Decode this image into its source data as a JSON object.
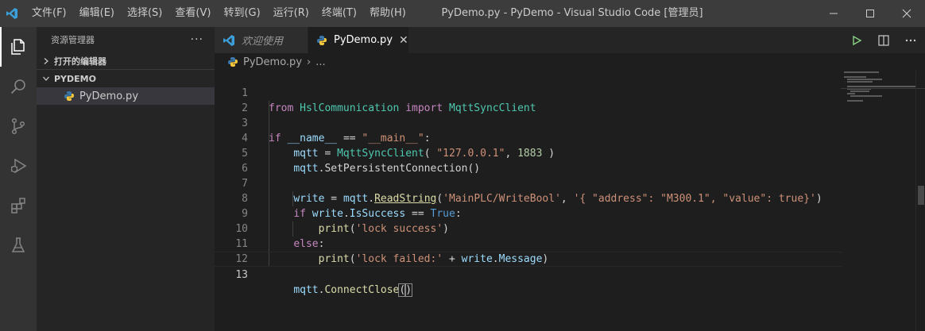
{
  "titlebar": {
    "menu": [
      "文件(F)",
      "编辑(E)",
      "选择(S)",
      "查看(V)",
      "转到(G)",
      "运行(R)",
      "终端(T)",
      "帮助(H)"
    ],
    "window_title": "PyDemo.py - PyDemo - Visual Studio Code [管理员]"
  },
  "activity_bar": {
    "items": [
      "explorer-icon",
      "search-icon",
      "source-control-icon",
      "run-debug-icon",
      "extensions-icon",
      "testing-icon"
    ]
  },
  "sidebar": {
    "title": "资源管理器",
    "more": "···",
    "open_editors": "打开的编辑器",
    "folder": "PYDEMO",
    "file": "PyDemo.py"
  },
  "tabs": [
    {
      "label": "欢迎使用",
      "active": false
    },
    {
      "label": "PyDemo.py",
      "active": true,
      "close": "✕"
    }
  ],
  "breadcrumb": {
    "file": "PyDemo.py",
    "separator": "›",
    "rest": "..."
  },
  "editor": {
    "line_numbers": [
      "1",
      "2",
      "3",
      "4",
      "5",
      "6",
      "7",
      "8",
      "9",
      "10",
      "11",
      "12",
      "13"
    ],
    "lines": [
      "from HslCommunication import MqttSyncClient",
      "",
      "if __name__ == \"__main__\":",
      "    mqtt = MqttSyncClient( \"127.0.0.1\", 1883 )",
      "    mqtt.SetPersistentConnection()",
      "",
      "    write = mqtt.ReadString('MainPLC/WriteBool', '{ \"address\": \"M300.1\", \"value\": true}')",
      "    if write.IsSuccess == True:",
      "        print('lock success')",
      "    else:",
      "        print('lock failed:' + write.Message)",
      "",
      "    mqtt.ConnectClose()"
    ],
    "current_line": 13
  },
  "colors": {
    "keyword": "#c586c0",
    "class": "#4ec9b0",
    "string": "#ce9178",
    "number": "#b5cea8",
    "variable": "#9cdcfe",
    "function": "#dcdcaa",
    "constant": "#569cd6"
  }
}
